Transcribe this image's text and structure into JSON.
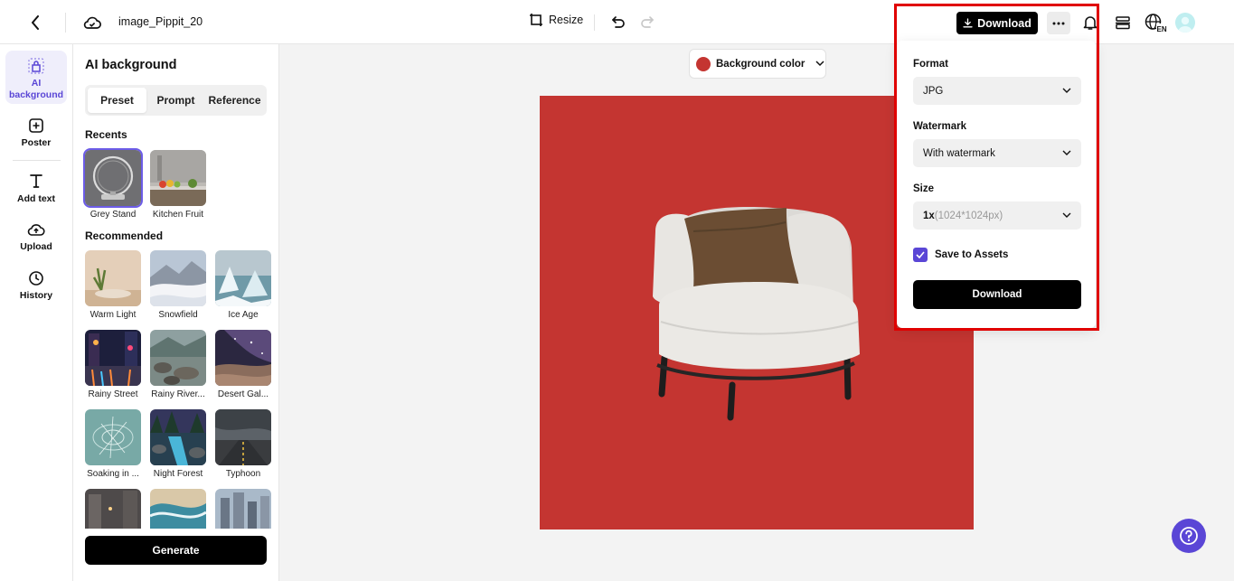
{
  "header": {
    "file_name": "image_Pippit_20",
    "resize_label": "Resize",
    "download_label": "Download",
    "lang_badge": "EN"
  },
  "rail": {
    "items": [
      {
        "label": "AI background",
        "icon": "bag-icon"
      },
      {
        "label": "Poster",
        "icon": "poster-icon"
      },
      {
        "label": "Add text",
        "icon": "text-icon"
      },
      {
        "label": "Upload",
        "icon": "upload-icon"
      },
      {
        "label": "History",
        "icon": "clock-icon"
      }
    ]
  },
  "panel": {
    "title": "AI background",
    "tabs": [
      "Preset",
      "Prompt",
      "Reference"
    ],
    "recents_title": "Recents",
    "recents": [
      "Grey Stand",
      "Kitchen Fruit"
    ],
    "recommended_title": "Recommended",
    "recommended": [
      "Warm Light",
      "Snowfield",
      "Ice Age",
      "Rainy Street",
      "Rainy River...",
      "Desert Gal...",
      "Soaking in ...",
      "Night Forest",
      "Typhoon"
    ],
    "generate_label": "Generate"
  },
  "canvas": {
    "bg_button_label": "Background color",
    "bg_color": "#c43531"
  },
  "download_menu": {
    "format_label": "Format",
    "format_value": "JPG",
    "watermark_label": "Watermark",
    "watermark_value": "With watermark",
    "size_label": "Size",
    "size_value_bold": "1x",
    "size_value_dim": "(1024*1024px)",
    "save_label": "Save to Assets",
    "save_checked": true,
    "download_label": "Download"
  },
  "colors": {
    "accent": "#5a46d6",
    "highlight": "#e00000"
  }
}
